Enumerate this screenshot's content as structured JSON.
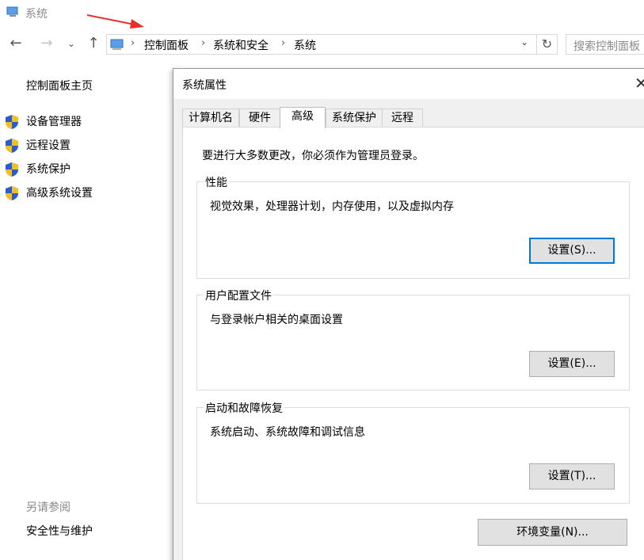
{
  "window": {
    "title": "系统",
    "icon": "computer-icon"
  },
  "nav": {
    "back_icon": "back-arrow-icon",
    "forward_icon": "forward-arrow-icon",
    "recent_icon": "chevron-down-icon",
    "up_icon": "up-arrow-icon",
    "breadcrumb": [
      "控制面板",
      "系统和安全",
      "系统"
    ],
    "search_placeholder": "搜索控制面板"
  },
  "sidebar": {
    "home": "控制面板主页",
    "items": [
      {
        "label": "设备管理器",
        "icon": "uac-shield-icon"
      },
      {
        "label": "远程设置",
        "icon": "uac-shield-icon"
      },
      {
        "label": "系统保护",
        "icon": "uac-shield-icon"
      },
      {
        "label": "高级系统设置",
        "icon": "uac-shield-icon"
      }
    ],
    "see_also_title": "另请参阅",
    "see_also_items": [
      "安全性与维护"
    ]
  },
  "dialog": {
    "title": "系统属性",
    "tabs": [
      "计算机名",
      "硬件",
      "高级",
      "系统保护",
      "远程"
    ],
    "active_tab": "高级",
    "intro": "要进行大多数更改，你必须作为管理员登录。",
    "groups": [
      {
        "title": "性能",
        "description": "视觉效果，处理器计划，内存使用，以及虚拟内存",
        "button": "设置(S)..."
      },
      {
        "title": "用户配置文件",
        "description": "与登录帐户相关的桌面设置",
        "button": "设置(E)..."
      },
      {
        "title": "启动和故障恢复",
        "description": "系统启动、系统故障和调试信息",
        "button": "设置(T)..."
      }
    ],
    "env_button": "环境变量(N)..."
  },
  "colors": {
    "annotation_arrow": "#e8302a",
    "focus_border": "#0078d7",
    "shield_blue": "#2a5bd7",
    "shield_yellow": "#f3c01b"
  }
}
